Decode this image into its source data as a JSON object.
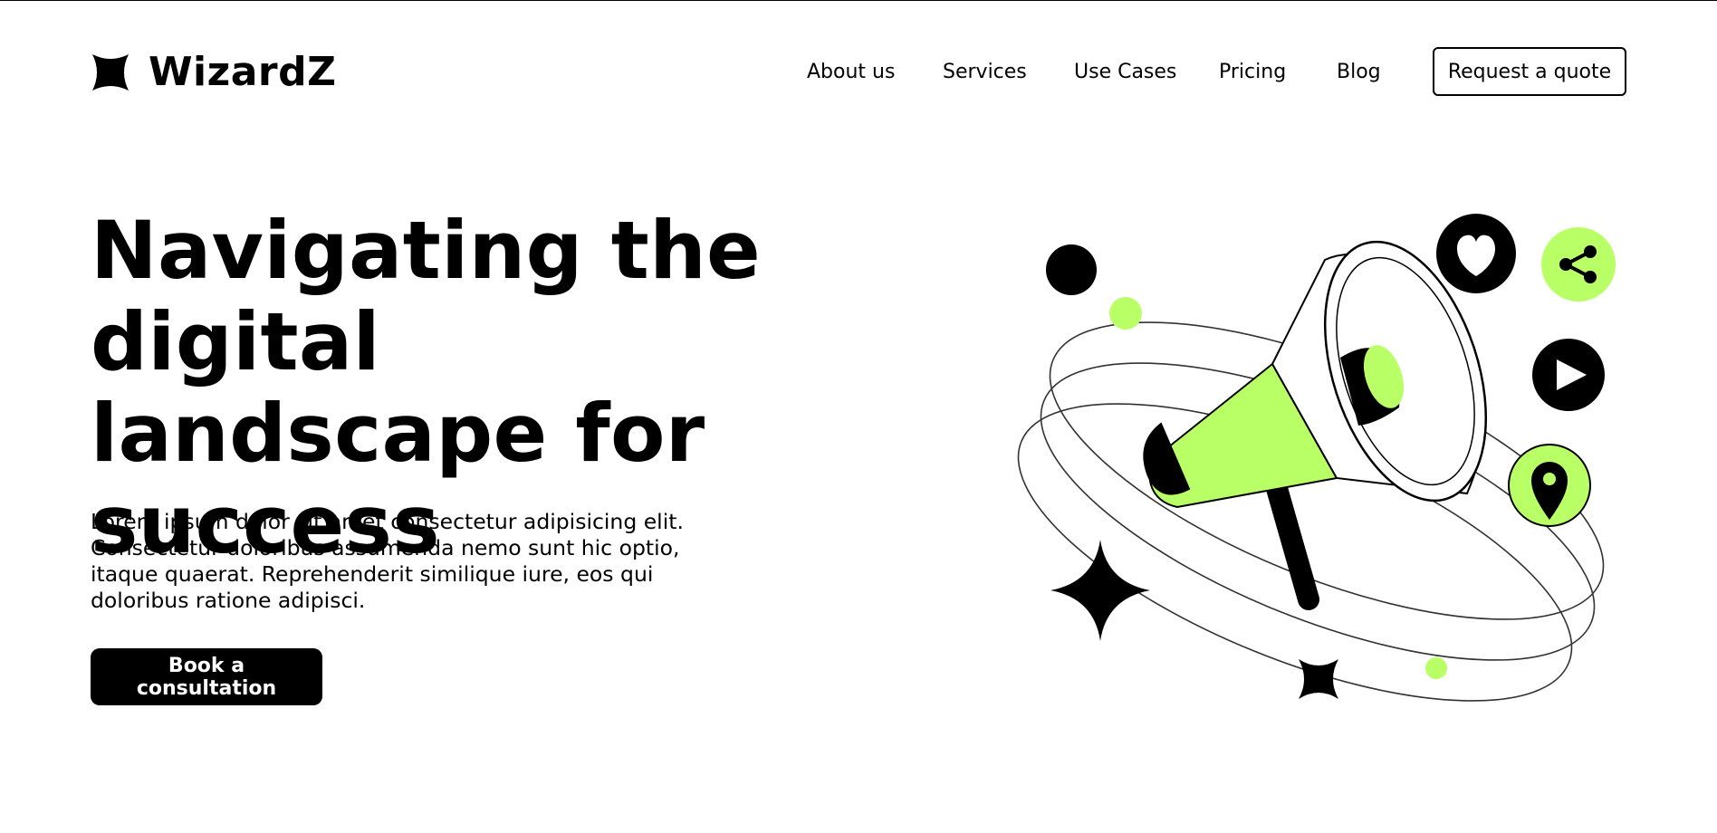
{
  "brand": {
    "name": "WizardZ",
    "logo_icon": "four-point-star-icon"
  },
  "nav": {
    "items": [
      {
        "label": "About us"
      },
      {
        "label": "Services"
      },
      {
        "label": "Use Cases"
      },
      {
        "label": "Pricing"
      },
      {
        "label": "Blog"
      }
    ],
    "cta_label": "Request a quote"
  },
  "hero": {
    "title": "Navigating the digital landscape for success",
    "description": "Lorem ipsum dolor sit amet consectetur adipisicing elit. Consectetur doloribus assumenda nemo sunt hic optio, itaque quaerat. Reprehenderit similique iure, eos qui doloribus ratione adipisci.",
    "button_label": "Book a consultation"
  },
  "illustration": {
    "icons": [
      "megaphone-icon",
      "heart-icon",
      "share-icon",
      "play-icon",
      "location-pin-icon",
      "sparkle-star-icon"
    ]
  },
  "colors": {
    "accent": "#B9FF66",
    "dark": "#000000",
    "background": "#FFFFFF"
  }
}
